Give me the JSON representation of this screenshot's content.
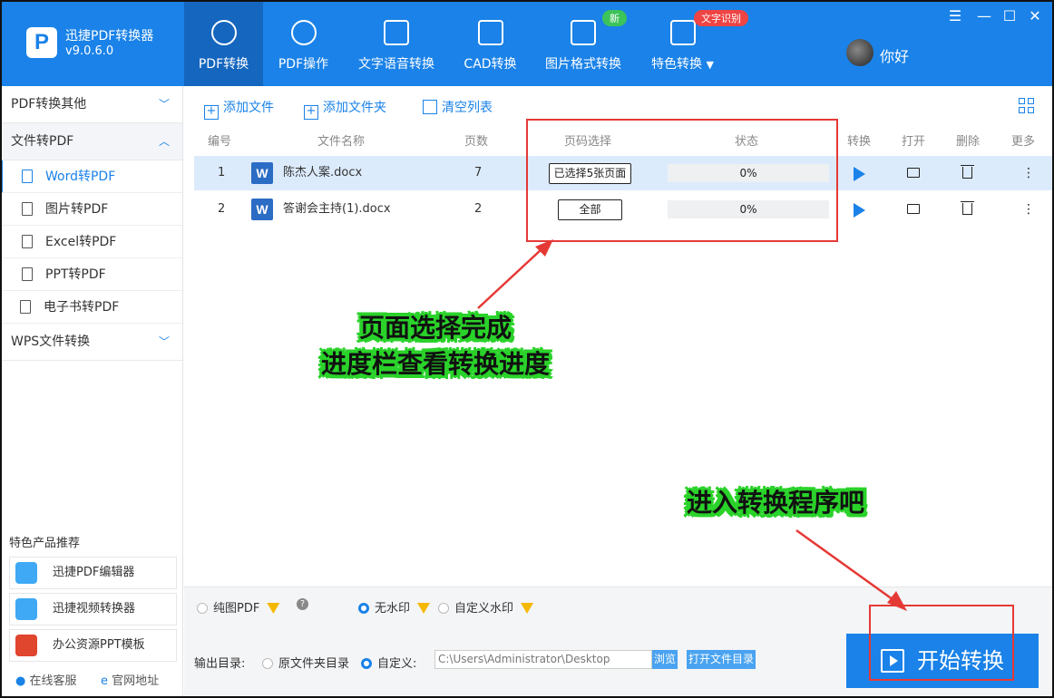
{
  "app": {
    "name": "迅捷PDF转换器",
    "version": "v9.0.6.0",
    "user": "你好",
    "logo": "P"
  },
  "nav": {
    "tabs": [
      {
        "label": "PDF转换"
      },
      {
        "label": "PDF操作"
      },
      {
        "label": "文字语音转换"
      },
      {
        "label": "CAD转换"
      },
      {
        "label": "图片格式转换"
      },
      {
        "label": "特色转换"
      }
    ],
    "badge_new": "新",
    "badge_ocr": "文字识别",
    "dropdown": "▼"
  },
  "window": {
    "menu": "☰",
    "minimize": "—",
    "maximize": "☐",
    "close": "✕"
  },
  "sidebar": {
    "groups": [
      "PDF转换其他",
      "文件转PDF",
      "WPS文件转换"
    ],
    "items": [
      "Word转PDF",
      "图片转PDF",
      "Excel转PDF",
      "PPT转PDF",
      "电子书转PDF"
    ],
    "chev_down": "﹀",
    "chev_up": "︿",
    "promo_title": "特色产品推荐",
    "promos": [
      "迅捷PDF编辑器",
      "迅捷视频转换器",
      "办公资源PPT模板"
    ],
    "footer": [
      "在线客服",
      "官网地址"
    ]
  },
  "toolbar": {
    "add_file": "添加文件",
    "add_folder": "添加文件夹",
    "clear_list": "清空列表"
  },
  "table": {
    "headers": [
      "编号",
      "文件名称",
      "页数",
      "页码选择",
      "状态",
      "转换",
      "打开",
      "删除",
      "更多"
    ],
    "rows": [
      {
        "num": "1",
        "name": "陈杰人案.docx",
        "pages": "7",
        "selection": "已选择5张页面",
        "status": "0%"
      },
      {
        "num": "2",
        "name": "答谢会主持(1).docx",
        "pages": "2",
        "selection": "全部",
        "status": "0%"
      }
    ]
  },
  "options": {
    "pure_pdf": "纯图PDF",
    "no_watermark": "无水印",
    "custom_watermark": "自定义水印",
    "help": "?"
  },
  "output": {
    "label": "输出目录:",
    "original": "原文件夹目录",
    "custom": "自定义:",
    "path": "C:\\Users\\Administrator\\Desktop",
    "browse": "浏览",
    "open_folder": "打开文件目录"
  },
  "start_button": "开始转换",
  "annotations": {
    "line1": "页面选择完成",
    "line2": "进度栏查看转换进度",
    "line3": "进入转换程序吧"
  },
  "colors": {
    "brand": "#1a82e8",
    "annotation_green": "#2ad22a",
    "highlight_red": "#e53935"
  }
}
